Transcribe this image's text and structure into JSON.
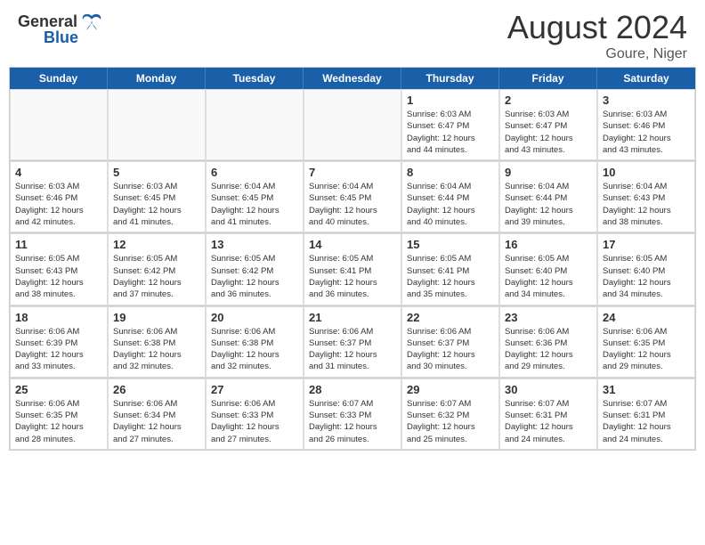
{
  "header": {
    "logo_text1": "General",
    "logo_text2": "Blue",
    "month_year": "August 2024",
    "location": "Goure, Niger"
  },
  "weekdays": [
    "Sunday",
    "Monday",
    "Tuesday",
    "Wednesday",
    "Thursday",
    "Friday",
    "Saturday"
  ],
  "weeks": [
    [
      {
        "day": "",
        "empty": true
      },
      {
        "day": "",
        "empty": true
      },
      {
        "day": "",
        "empty": true
      },
      {
        "day": "",
        "empty": true
      },
      {
        "day": "1",
        "info": "Sunrise: 6:03 AM\nSunset: 6:47 PM\nDaylight: 12 hours\nand 44 minutes."
      },
      {
        "day": "2",
        "info": "Sunrise: 6:03 AM\nSunset: 6:47 PM\nDaylight: 12 hours\nand 43 minutes."
      },
      {
        "day": "3",
        "info": "Sunrise: 6:03 AM\nSunset: 6:46 PM\nDaylight: 12 hours\nand 43 minutes."
      }
    ],
    [
      {
        "day": "4",
        "info": "Sunrise: 6:03 AM\nSunset: 6:46 PM\nDaylight: 12 hours\nand 42 minutes."
      },
      {
        "day": "5",
        "info": "Sunrise: 6:03 AM\nSunset: 6:45 PM\nDaylight: 12 hours\nand 41 minutes."
      },
      {
        "day": "6",
        "info": "Sunrise: 6:04 AM\nSunset: 6:45 PM\nDaylight: 12 hours\nand 41 minutes."
      },
      {
        "day": "7",
        "info": "Sunrise: 6:04 AM\nSunset: 6:45 PM\nDaylight: 12 hours\nand 40 minutes."
      },
      {
        "day": "8",
        "info": "Sunrise: 6:04 AM\nSunset: 6:44 PM\nDaylight: 12 hours\nand 40 minutes."
      },
      {
        "day": "9",
        "info": "Sunrise: 6:04 AM\nSunset: 6:44 PM\nDaylight: 12 hours\nand 39 minutes."
      },
      {
        "day": "10",
        "info": "Sunrise: 6:04 AM\nSunset: 6:43 PM\nDaylight: 12 hours\nand 38 minutes."
      }
    ],
    [
      {
        "day": "11",
        "info": "Sunrise: 6:05 AM\nSunset: 6:43 PM\nDaylight: 12 hours\nand 38 minutes."
      },
      {
        "day": "12",
        "info": "Sunrise: 6:05 AM\nSunset: 6:42 PM\nDaylight: 12 hours\nand 37 minutes."
      },
      {
        "day": "13",
        "info": "Sunrise: 6:05 AM\nSunset: 6:42 PM\nDaylight: 12 hours\nand 36 minutes."
      },
      {
        "day": "14",
        "info": "Sunrise: 6:05 AM\nSunset: 6:41 PM\nDaylight: 12 hours\nand 36 minutes."
      },
      {
        "day": "15",
        "info": "Sunrise: 6:05 AM\nSunset: 6:41 PM\nDaylight: 12 hours\nand 35 minutes."
      },
      {
        "day": "16",
        "info": "Sunrise: 6:05 AM\nSunset: 6:40 PM\nDaylight: 12 hours\nand 34 minutes."
      },
      {
        "day": "17",
        "info": "Sunrise: 6:05 AM\nSunset: 6:40 PM\nDaylight: 12 hours\nand 34 minutes."
      }
    ],
    [
      {
        "day": "18",
        "info": "Sunrise: 6:06 AM\nSunset: 6:39 PM\nDaylight: 12 hours\nand 33 minutes."
      },
      {
        "day": "19",
        "info": "Sunrise: 6:06 AM\nSunset: 6:38 PM\nDaylight: 12 hours\nand 32 minutes."
      },
      {
        "day": "20",
        "info": "Sunrise: 6:06 AM\nSunset: 6:38 PM\nDaylight: 12 hours\nand 32 minutes."
      },
      {
        "day": "21",
        "info": "Sunrise: 6:06 AM\nSunset: 6:37 PM\nDaylight: 12 hours\nand 31 minutes."
      },
      {
        "day": "22",
        "info": "Sunrise: 6:06 AM\nSunset: 6:37 PM\nDaylight: 12 hours\nand 30 minutes."
      },
      {
        "day": "23",
        "info": "Sunrise: 6:06 AM\nSunset: 6:36 PM\nDaylight: 12 hours\nand 29 minutes."
      },
      {
        "day": "24",
        "info": "Sunrise: 6:06 AM\nSunset: 6:35 PM\nDaylight: 12 hours\nand 29 minutes."
      }
    ],
    [
      {
        "day": "25",
        "info": "Sunrise: 6:06 AM\nSunset: 6:35 PM\nDaylight: 12 hours\nand 28 minutes."
      },
      {
        "day": "26",
        "info": "Sunrise: 6:06 AM\nSunset: 6:34 PM\nDaylight: 12 hours\nand 27 minutes."
      },
      {
        "day": "27",
        "info": "Sunrise: 6:06 AM\nSunset: 6:33 PM\nDaylight: 12 hours\nand 27 minutes."
      },
      {
        "day": "28",
        "info": "Sunrise: 6:07 AM\nSunset: 6:33 PM\nDaylight: 12 hours\nand 26 minutes."
      },
      {
        "day": "29",
        "info": "Sunrise: 6:07 AM\nSunset: 6:32 PM\nDaylight: 12 hours\nand 25 minutes."
      },
      {
        "day": "30",
        "info": "Sunrise: 6:07 AM\nSunset: 6:31 PM\nDaylight: 12 hours\nand 24 minutes."
      },
      {
        "day": "31",
        "info": "Sunrise: 6:07 AM\nSunset: 6:31 PM\nDaylight: 12 hours\nand 24 minutes."
      }
    ]
  ]
}
